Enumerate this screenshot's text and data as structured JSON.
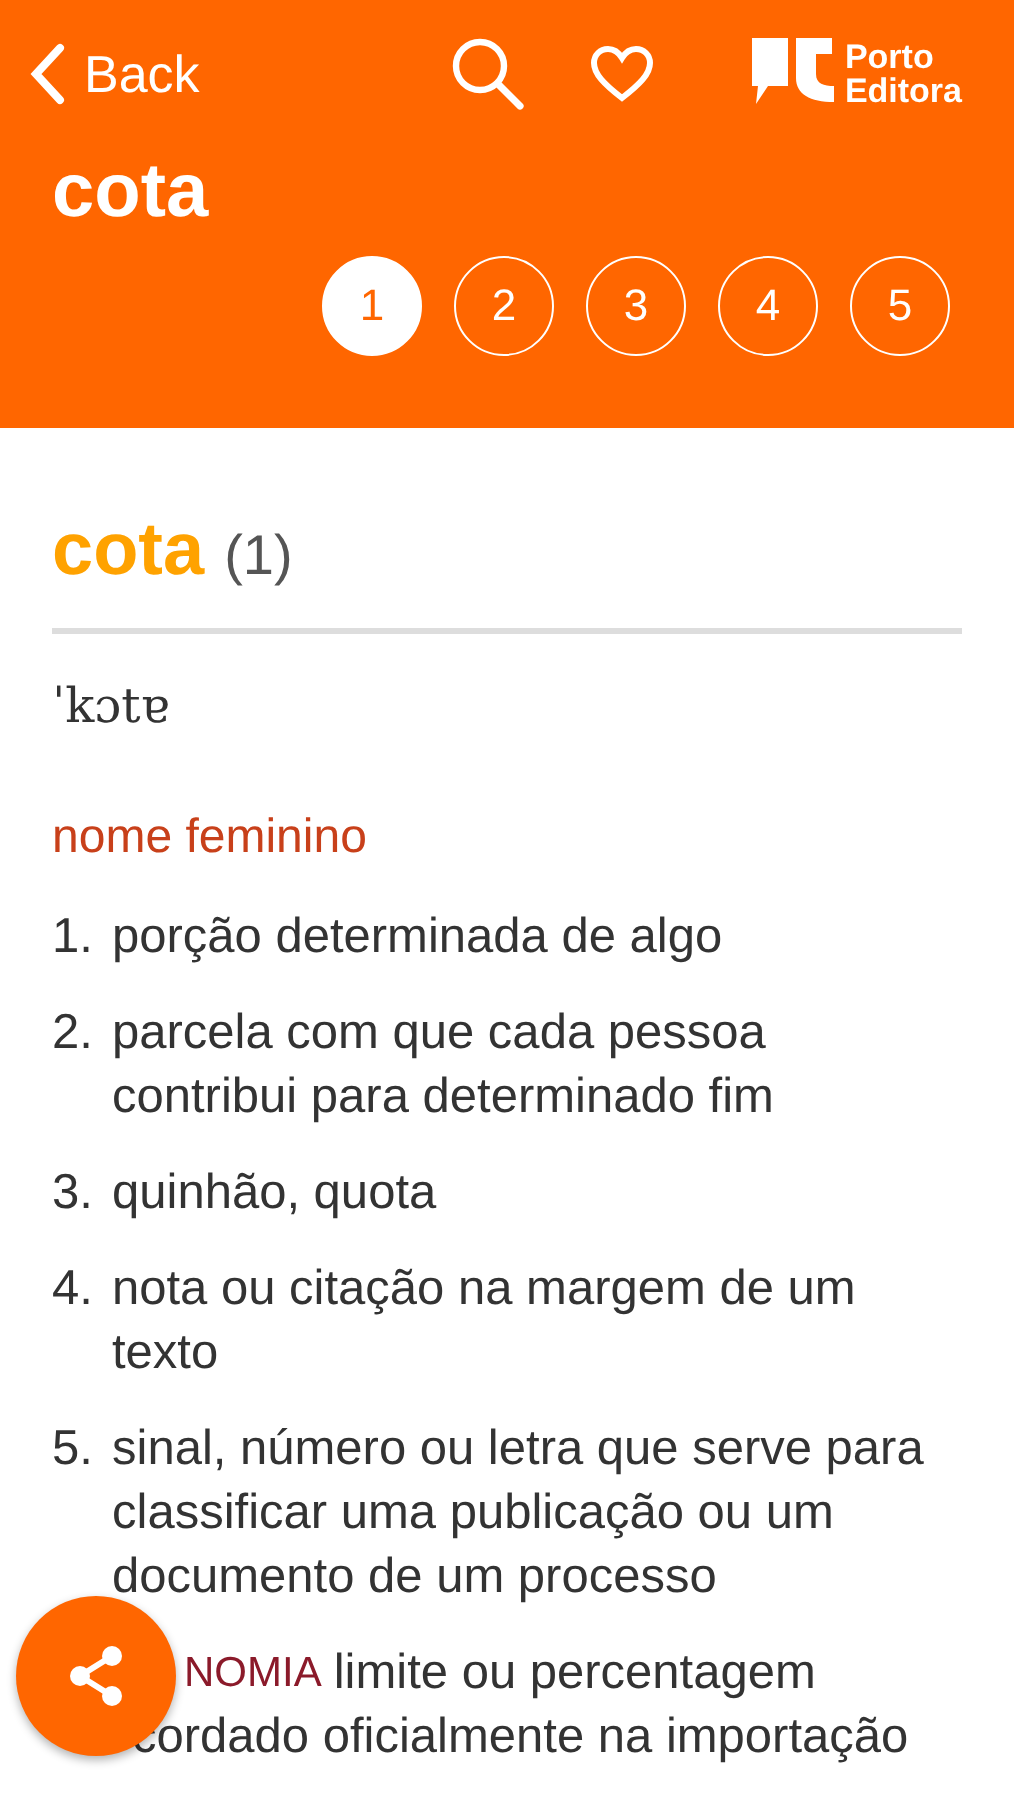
{
  "header": {
    "back_label": "Back",
    "title": "cota",
    "logo_line1": "Porto",
    "logo_line2": "Editora",
    "senses": [
      {
        "label": "1",
        "selected": true
      },
      {
        "label": "2",
        "selected": false
      },
      {
        "label": "3",
        "selected": false
      },
      {
        "label": "4",
        "selected": false
      },
      {
        "label": "5",
        "selected": false
      }
    ]
  },
  "entry": {
    "headword": "cota",
    "homograph": "(1)",
    "pronunciation": "ˈkɔtɐ",
    "part_of_speech": "nome feminino",
    "definitions": [
      {
        "number": "1.",
        "text": "porção determinada de algo"
      },
      {
        "number": "2.",
        "text": "parcela com que cada pessoa contribui para determinado fim"
      },
      {
        "number": "3.",
        "text": "quinhão, quota"
      },
      {
        "number": "4.",
        "text": "nota ou citação na margem de um texto"
      },
      {
        "number": "5.",
        "text": "sinal, número ou letra que serve para classificar uma publicação ou um documento de um processo"
      },
      {
        "domain": "NOMIA",
        "text": "limite ou percentagem",
        "text_line2": "cordado oficialmente na importação"
      }
    ]
  }
}
